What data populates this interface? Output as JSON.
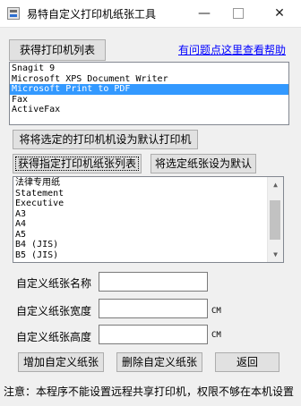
{
  "window": {
    "title": "易特自定义打印机纸张工具",
    "minimize_glyph": "—",
    "close_glyph": "✕"
  },
  "top": {
    "get_printers_label": "获得打印机列表",
    "help_link": "有问题点这里查看帮助"
  },
  "printers": {
    "items": [
      "Snagit 9",
      "Microsoft XPS Document Writer",
      "Microsoft Print to PDF",
      "Fax",
      "ActiveFax"
    ],
    "selected_index": 2
  },
  "actions": {
    "set_default_printer_label": "将将选定的打印机机设为默认打印机",
    "get_papers_label": "获得指定打印机纸张列表",
    "set_default_paper_label": "将选定纸张设为默认"
  },
  "papers": {
    "items": [
      "法律专用纸",
      "Statement",
      "Executive",
      "A3",
      "A4",
      "A5",
      "B4 (JIS)",
      "B5 (JIS)"
    ]
  },
  "form": {
    "name_label": "自定义纸张名称",
    "width_label": "自定义纸张宽度",
    "height_label": "自定义纸张高度",
    "name_value": "",
    "width_value": "",
    "height_value": "",
    "unit": "CM"
  },
  "bottom": {
    "add_label": "增加自定义纸张",
    "delete_label": "删除自定义纸张",
    "back_label": "返回"
  },
  "status": {
    "note": "注意：本程序不能设置远程共享打印机，权限不够在本机设置"
  },
  "colors": {
    "selection": "#3399ff",
    "link": "#0000ff",
    "background": "#f0f0f0"
  }
}
